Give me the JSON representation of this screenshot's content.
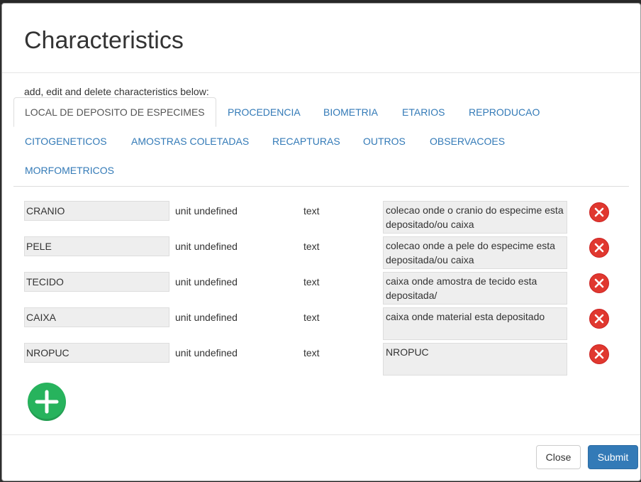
{
  "modal": {
    "title": "Characteristics",
    "intro": "add, edit and delete characteristics below:"
  },
  "tabs": [
    {
      "label": "LOCAL DE DEPOSITO DE ESPECIMES",
      "active": true
    },
    {
      "label": "PROCEDENCIA"
    },
    {
      "label": "BIOMETRIA"
    },
    {
      "label": "ETARIOS"
    },
    {
      "label": "REPRODUCAO"
    },
    {
      "label": "CITOGENETICOS"
    },
    {
      "label": "AMOSTRAS COLETADAS"
    },
    {
      "label": "RECAPTURAS"
    },
    {
      "label": "OUTROS"
    },
    {
      "label": "OBSERVACOES"
    },
    {
      "label": "MORFOMETRICOS"
    }
  ],
  "rows": [
    {
      "name": "CRANIO",
      "unit": "unit undefined",
      "type": "text",
      "description": "colecao onde o cranio do especime esta depositado/ou caixa"
    },
    {
      "name": "PELE",
      "unit": "unit undefined",
      "type": "text",
      "description": "colecao onde a pele do especime esta depositada/ou caixa"
    },
    {
      "name": "TECIDO",
      "unit": "unit undefined",
      "type": "text",
      "description": "caixa onde amostra de tecido esta depositada/"
    },
    {
      "name": "CAIXA",
      "unit": "unit undefined",
      "type": "text",
      "description": "caixa onde material esta depositado"
    },
    {
      "name": "NROPUC",
      "unit": "unit undefined",
      "type": "text",
      "description": "NROPUC"
    }
  ],
  "footer": {
    "close_label": "Close",
    "submit_label": "Submit"
  },
  "icons": {
    "delete": "close-circle-icon",
    "add": "plus-circle-icon"
  },
  "colors": {
    "link": "#337ab7",
    "delete": "#e0382f",
    "add": "#27b35d",
    "primary": "#337ab7"
  }
}
